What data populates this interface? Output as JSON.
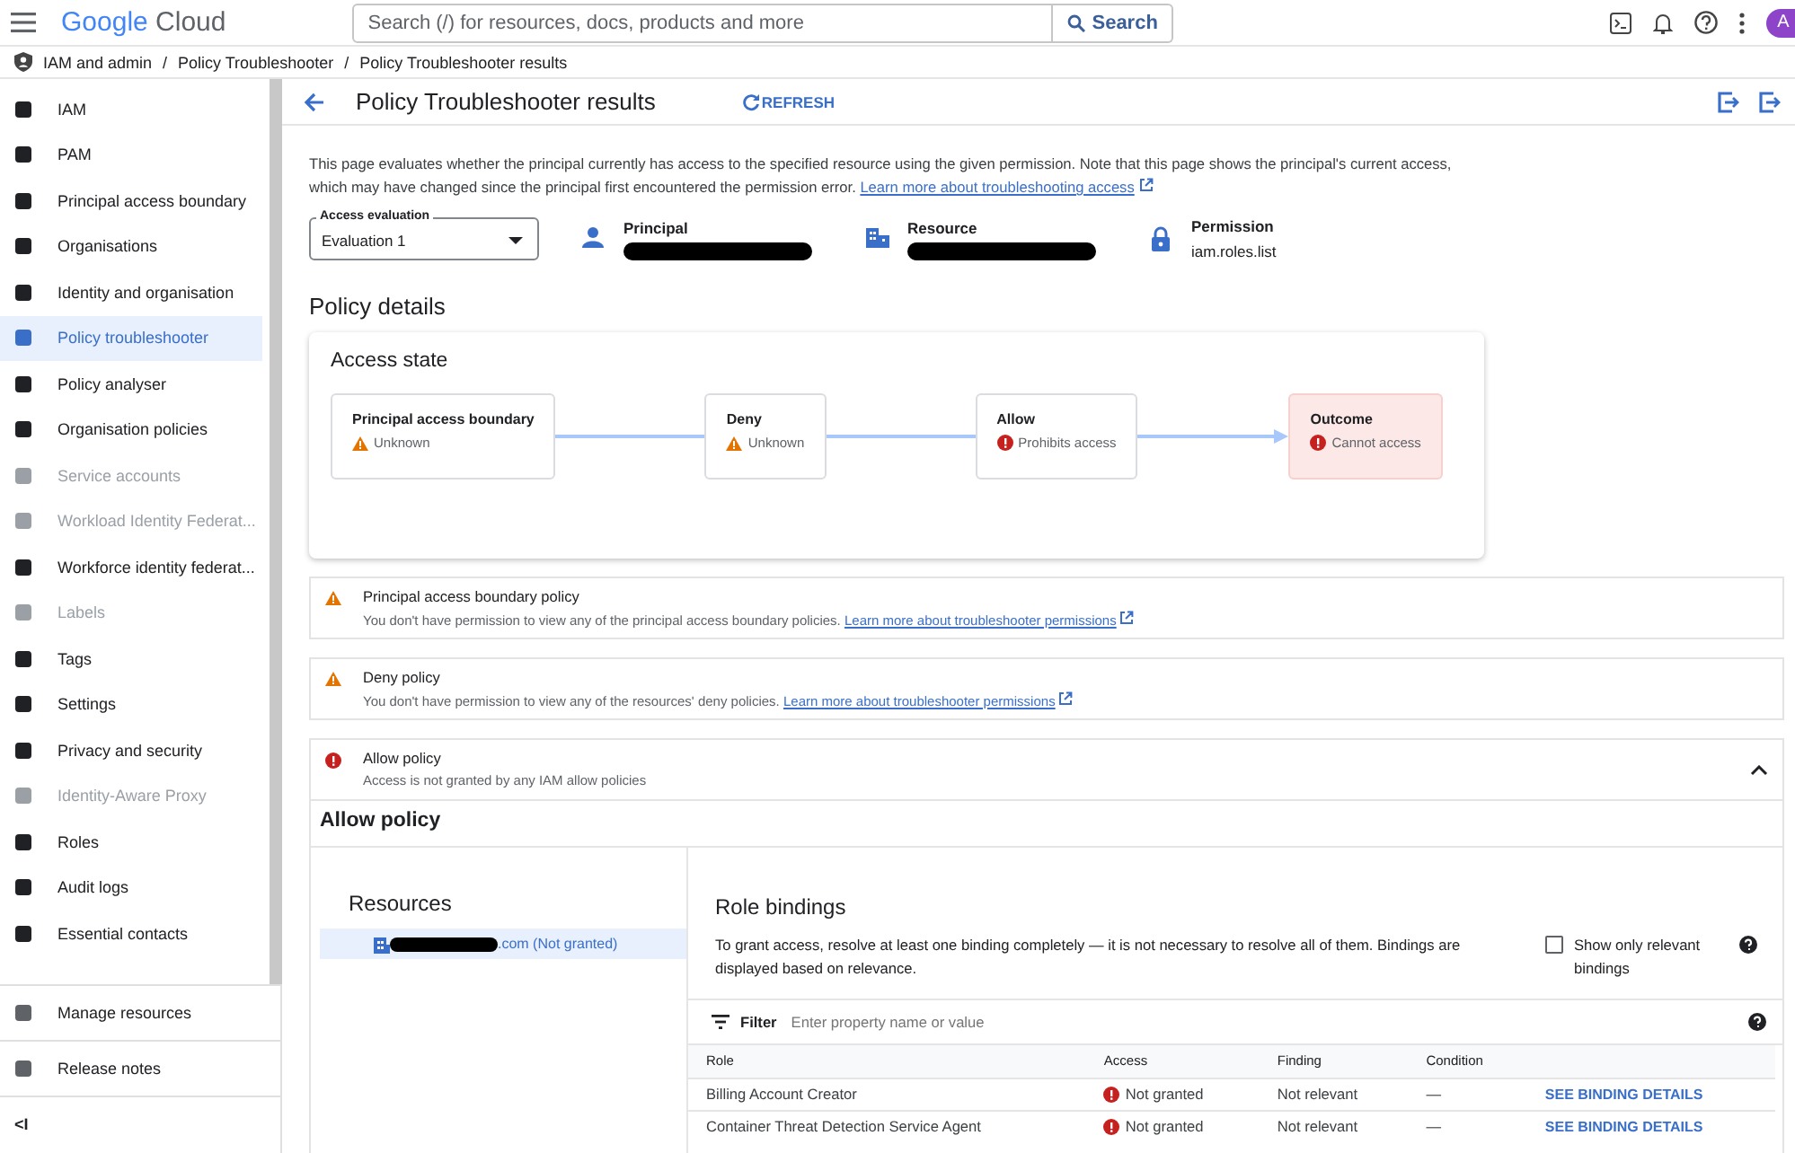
{
  "topbar": {
    "logo": {
      "word1": "Google",
      "word2": "Cloud"
    },
    "search": {
      "placeholder": "Search (/) for resources, docs, products and more"
    },
    "search_button": "Search",
    "avatar": "A"
  },
  "breadcrumb": {
    "separator": "/",
    "items": [
      "IAM and admin",
      "Policy Troubleshooter",
      "Policy Troubleshooter results"
    ]
  },
  "sidebar": {
    "items": [
      {
        "label": "IAM",
        "selected": false,
        "disabled": false
      },
      {
        "label": "PAM",
        "selected": false,
        "disabled": false
      },
      {
        "label": "Principal access boundary",
        "selected": false,
        "disabled": false
      },
      {
        "label": "Organisations",
        "selected": false,
        "disabled": false
      },
      {
        "label": "Identity and organisation",
        "selected": false,
        "disabled": false
      },
      {
        "label": "Policy troubleshooter",
        "selected": true,
        "disabled": false
      },
      {
        "label": "Policy analyser",
        "selected": false,
        "disabled": false
      },
      {
        "label": "Organisation policies",
        "selected": false,
        "disabled": false
      },
      {
        "label": "Service accounts",
        "selected": false,
        "disabled": true
      },
      {
        "label": "Workload Identity Federat...",
        "selected": false,
        "disabled": true
      },
      {
        "label": "Workforce identity federat...",
        "selected": false,
        "disabled": false
      },
      {
        "label": "Labels",
        "selected": false,
        "disabled": true
      },
      {
        "label": "Tags",
        "selected": false,
        "disabled": false
      },
      {
        "label": "Settings",
        "selected": false,
        "disabled": false
      },
      {
        "label": "Privacy and security",
        "selected": false,
        "disabled": false
      },
      {
        "label": "Identity-Aware Proxy",
        "selected": false,
        "disabled": true
      },
      {
        "label": "Roles",
        "selected": false,
        "disabled": false
      },
      {
        "label": "Audit logs",
        "selected": false,
        "disabled": false
      },
      {
        "label": "Essential contacts",
        "selected": false,
        "disabled": false
      }
    ],
    "footer": [
      "Manage resources",
      "Release notes"
    ],
    "collapse": "<I"
  },
  "page": {
    "title": "Policy Troubleshooter results",
    "refresh": "REFRESH",
    "intro": {
      "text": "This page evaluates whether the principal currently has access to the specified resource using the given permission. Note that this page shows the principal's current access, which may have changed since the principal first encountered the permission error.",
      "link": "Learn more about troubleshooting access"
    },
    "evaluation": {
      "label": "Access evaluation",
      "value": "Evaluation 1"
    },
    "summary": [
      {
        "kind": "person",
        "label": "Principal",
        "redacted": true
      },
      {
        "kind": "building",
        "label": "Resource",
        "redacted": true
      },
      {
        "kind": "lock",
        "label": "Permission",
        "value": "iam.roles.list"
      }
    ],
    "details_title": "Policy details",
    "access_state": {
      "title": "Access state",
      "nodes": [
        {
          "title": "Principal access boundary",
          "kind": "warning",
          "text": "Unknown",
          "highlight": false
        },
        {
          "title": "Deny",
          "kind": "warning",
          "text": "Unknown",
          "highlight": false
        },
        {
          "title": "Allow",
          "kind": "error",
          "text": "Prohibits access",
          "highlight": false
        },
        {
          "title": "Outcome",
          "kind": "error",
          "text": "Cannot access",
          "highlight": true
        }
      ]
    },
    "policies": [
      {
        "kind": "warning",
        "title": "Principal access boundary policy",
        "text": "You don't have permission to view any of the principal access boundary policies.",
        "link": "Learn more about troubleshooter permissions",
        "expanded": false
      },
      {
        "kind": "warning",
        "title": "Deny policy",
        "text": "You don't have permission to view any of the resources' deny policies.",
        "link": "Learn more about troubleshooter permissions",
        "expanded": false
      },
      {
        "kind": "error",
        "title": "Allow policy",
        "text": "Access is not granted by any IAM allow policies",
        "expanded": true
      }
    ],
    "allow_policy": {
      "title": "Allow policy",
      "resources_title": "Resources",
      "resources": [
        {
          "label": ".com (Not granted)",
          "redacted": true,
          "selected": true
        }
      ],
      "bindings_title": "Role bindings",
      "bindings_text": "To grant access, resolve at least one binding completely — it is not necessary to resolve all of them. Bindings are displayed based on relevance.",
      "relevant_checkbox": {
        "label": "Show only relevant bindings",
        "checked": false
      },
      "filter": {
        "label": "Filter",
        "placeholder": "Enter property name or value"
      },
      "columns": [
        "Role",
        "Access",
        "Finding",
        "Condition"
      ],
      "rows": [
        {
          "role": "Billing Account Creator",
          "access": "Not granted",
          "finding": "Not relevant",
          "condition": "—",
          "link": "SEE BINDING DETAILS"
        },
        {
          "role": "Container Threat Detection Service Agent",
          "access": "Not granted",
          "finding": "Not relevant",
          "condition": "—",
          "link": "SEE BINDING DETAILS"
        }
      ]
    }
  }
}
